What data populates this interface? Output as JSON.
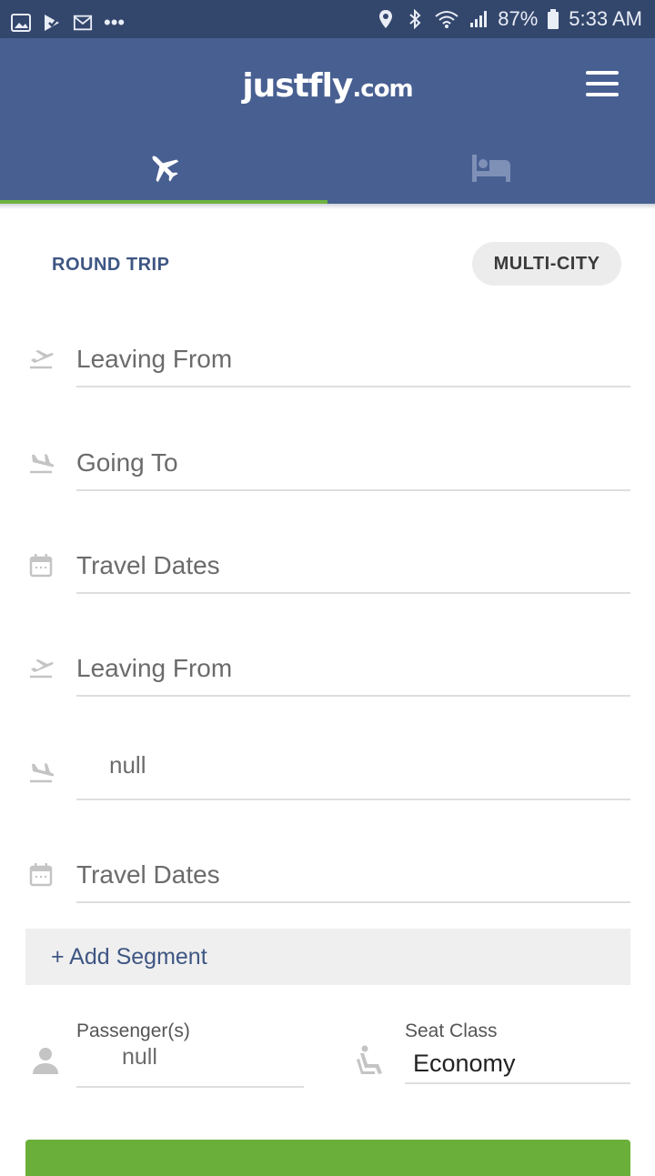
{
  "status_bar": {
    "battery": "87%",
    "time": "5:33 AM",
    "dots": "•••"
  },
  "header": {
    "brand_name": "justfly",
    "brand_suffix": ".com"
  },
  "tabs": [
    {
      "name": "flights",
      "icon": "airplane-icon",
      "active": true
    },
    {
      "name": "hotels",
      "icon": "bed-icon",
      "active": false
    }
  ],
  "trip_type": {
    "round_trip": "ROUND TRIP",
    "multi_city": "MULTI-CITY",
    "selected": "MULTI-CITY"
  },
  "segments": [
    {
      "leaving": "Leaving From",
      "going": "Going To",
      "dates": "Travel Dates"
    },
    {
      "leaving": "Leaving From",
      "going": "null",
      "dates": "Travel Dates"
    }
  ],
  "add_segment": "+ Add Segment",
  "passengers": {
    "label": "Passenger(s)",
    "value": "null"
  },
  "seat_class": {
    "label": "Seat Class",
    "value": "Economy"
  },
  "colors": {
    "status_bar": "#33466c",
    "header": "#485f91",
    "accent_green": "#6db33f",
    "link_blue": "#3e5683"
  }
}
